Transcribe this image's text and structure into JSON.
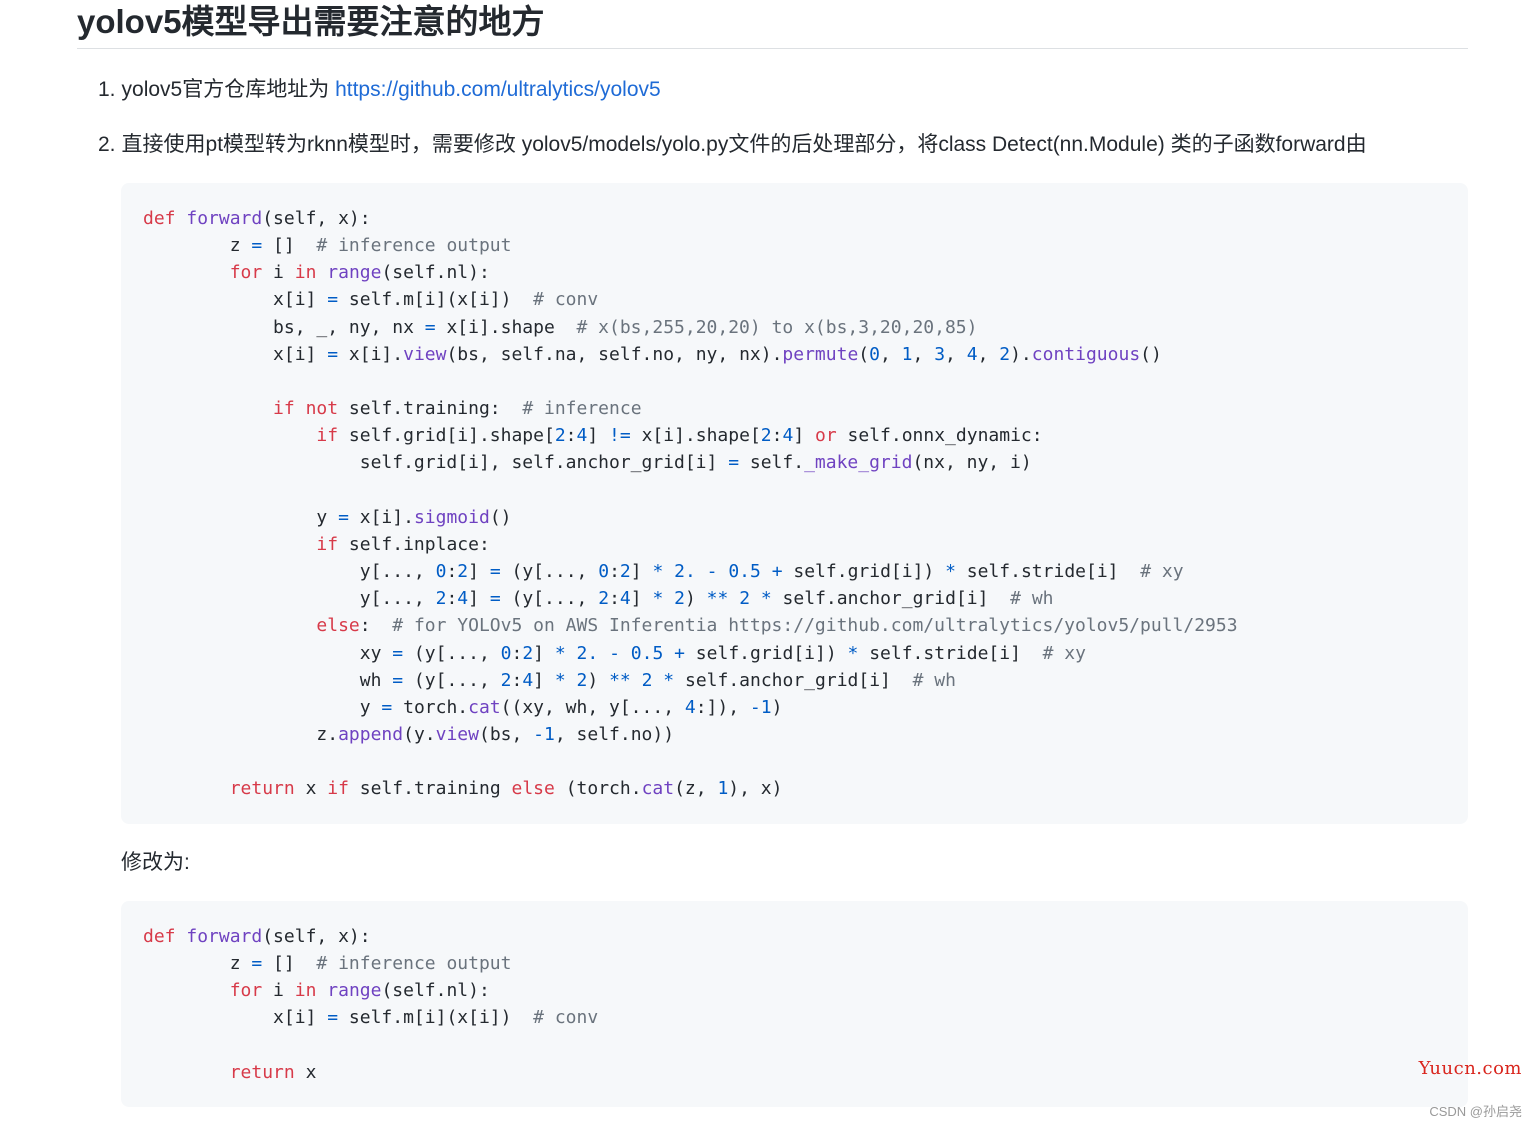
{
  "heading": "yolov5模型导出需要注意的地方",
  "list": [
    {
      "number": "1.",
      "text": "yolov5官方仓库地址为 ",
      "link": "https://github.com/ultralytics/yolov5"
    },
    {
      "number": "2.",
      "text": "直接使用pt模型转为rknn模型时，需要修改 yolov5/models/yolo.py文件的后处理部分，将class Detect(nn.Module) 类的子函数forward由"
    }
  ],
  "modify_label": "修改为:",
  "code_blocks": [
    {
      "language": "python",
      "lines": [
        "def forward(self, x):",
        "        z = []  # inference output",
        "        for i in range(self.nl):",
        "            x[i] = self.m[i](x[i])  # conv",
        "            bs, _, ny, nx = x[i].shape  # x(bs,255,20,20) to x(bs,3,20,20,85)",
        "            x[i] = x[i].view(bs, self.na, self.no, ny, nx).permute(0, 1, 3, 4, 2).contiguous()",
        "",
        "            if not self.training:  # inference",
        "                if self.grid[i].shape[2:4] != x[i].shape[2:4] or self.onnx_dynamic:",
        "                    self.grid[i], self.anchor_grid[i] = self._make_grid(nx, ny, i)",
        "",
        "                y = x[i].sigmoid()",
        "                if self.inplace:",
        "                    y[..., 0:2] = (y[..., 0:2] * 2. - 0.5 + self.grid[i]) * self.stride[i]  # xy",
        "                    y[..., 2:4] = (y[..., 2:4] * 2) ** 2 * self.anchor_grid[i]  # wh",
        "                else:  # for YOLOv5 on AWS Inferentia https://github.com/ultralytics/yolov5/pull/2953",
        "                    xy = (y[..., 0:2] * 2. - 0.5 + self.grid[i]) * self.stride[i]  # xy",
        "                    wh = (y[..., 2:4] * 2) ** 2 * self.anchor_grid[i]  # wh",
        "                    y = torch.cat((xy, wh, y[..., 4:]), -1)",
        "                z.append(y.view(bs, -1, self.no))",
        "",
        "        return x if self.training else (torch.cat(z, 1), x)"
      ]
    },
    {
      "language": "python",
      "lines": [
        "def forward(self, x):",
        "        z = []  # inference output",
        "        for i in range(self.nl):",
        "            x[i] = self.m[i](x[i])  # conv",
        "",
        "        return x"
      ]
    }
  ],
  "watermarks": {
    "site": "Yuucn.com",
    "author": "CSDN @孙启尧"
  },
  "colors": {
    "keyword": "#d73a49",
    "function": "#6f42c1",
    "number": "#005cc5",
    "comment": "#6a737d",
    "link": "#1f6bd6",
    "code_bg": "#f6f8fa",
    "watermark_site": "#d9251d"
  }
}
